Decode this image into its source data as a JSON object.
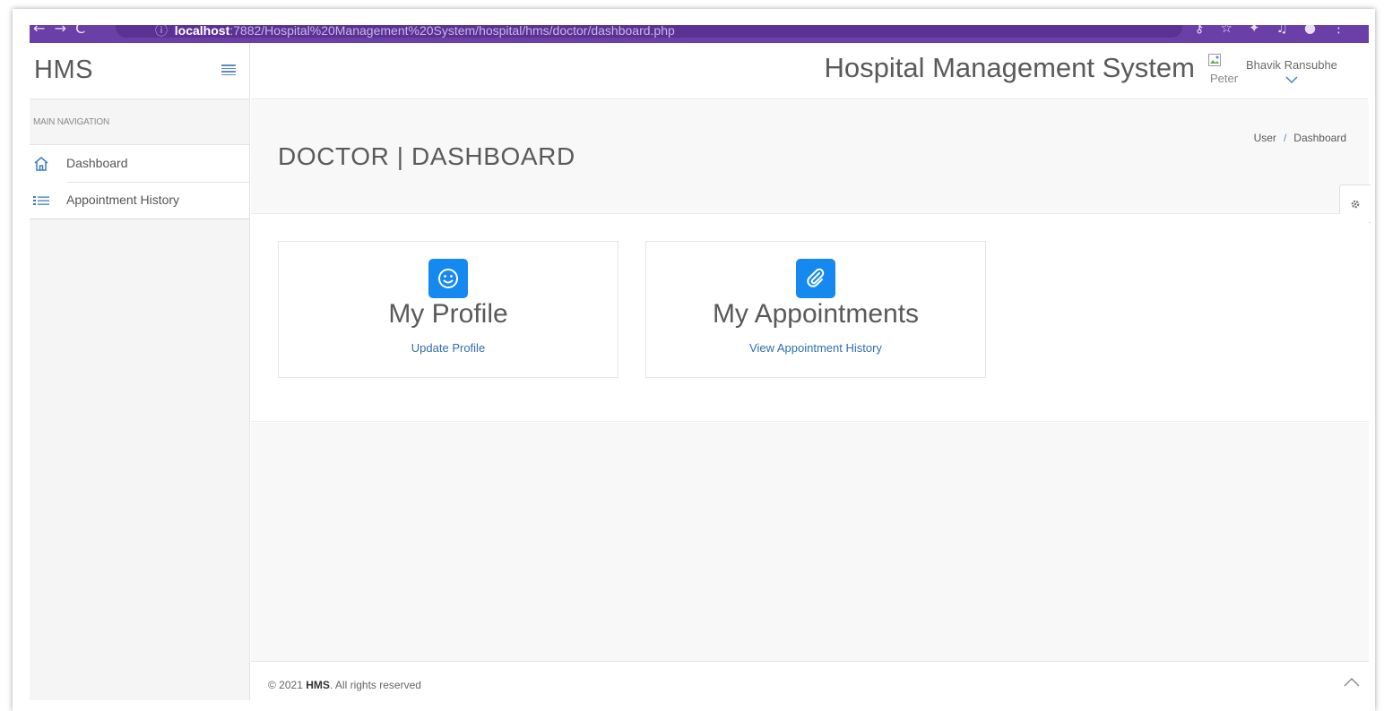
{
  "browser": {
    "url_host": "localhost",
    "url_path": ":7882/Hospital%20Management%20System/hospital/hms/doctor/dashboard.php"
  },
  "sidebar": {
    "brand": "HMS",
    "nav_heading": "MAIN NAVIGATION",
    "items": [
      {
        "label": "Dashboard",
        "icon": "home-icon"
      },
      {
        "label": "Appointment History",
        "icon": "list-icon"
      }
    ]
  },
  "header": {
    "title": "Hospital Management System",
    "avatar_alt": "Peter",
    "username": "Bhavik Ransubhe"
  },
  "page": {
    "title": "DOCTOR | DASHBOARD",
    "breadcrumb": [
      "User",
      "Dashboard"
    ]
  },
  "cards": [
    {
      "title": "My Profile",
      "link": "Update Profile",
      "icon": "smile-icon"
    },
    {
      "title": "My Appointments",
      "link": "View Appointment History",
      "icon": "paperclip-icon"
    }
  ],
  "footer": {
    "copyright_prefix": "© 2021",
    "brand": "HMS",
    "copyright_suffix": ". All rights reserved"
  },
  "colors": {
    "accent": "#1589f0",
    "browser_bar": "#6a3fa8",
    "link": "#2f6db5"
  }
}
